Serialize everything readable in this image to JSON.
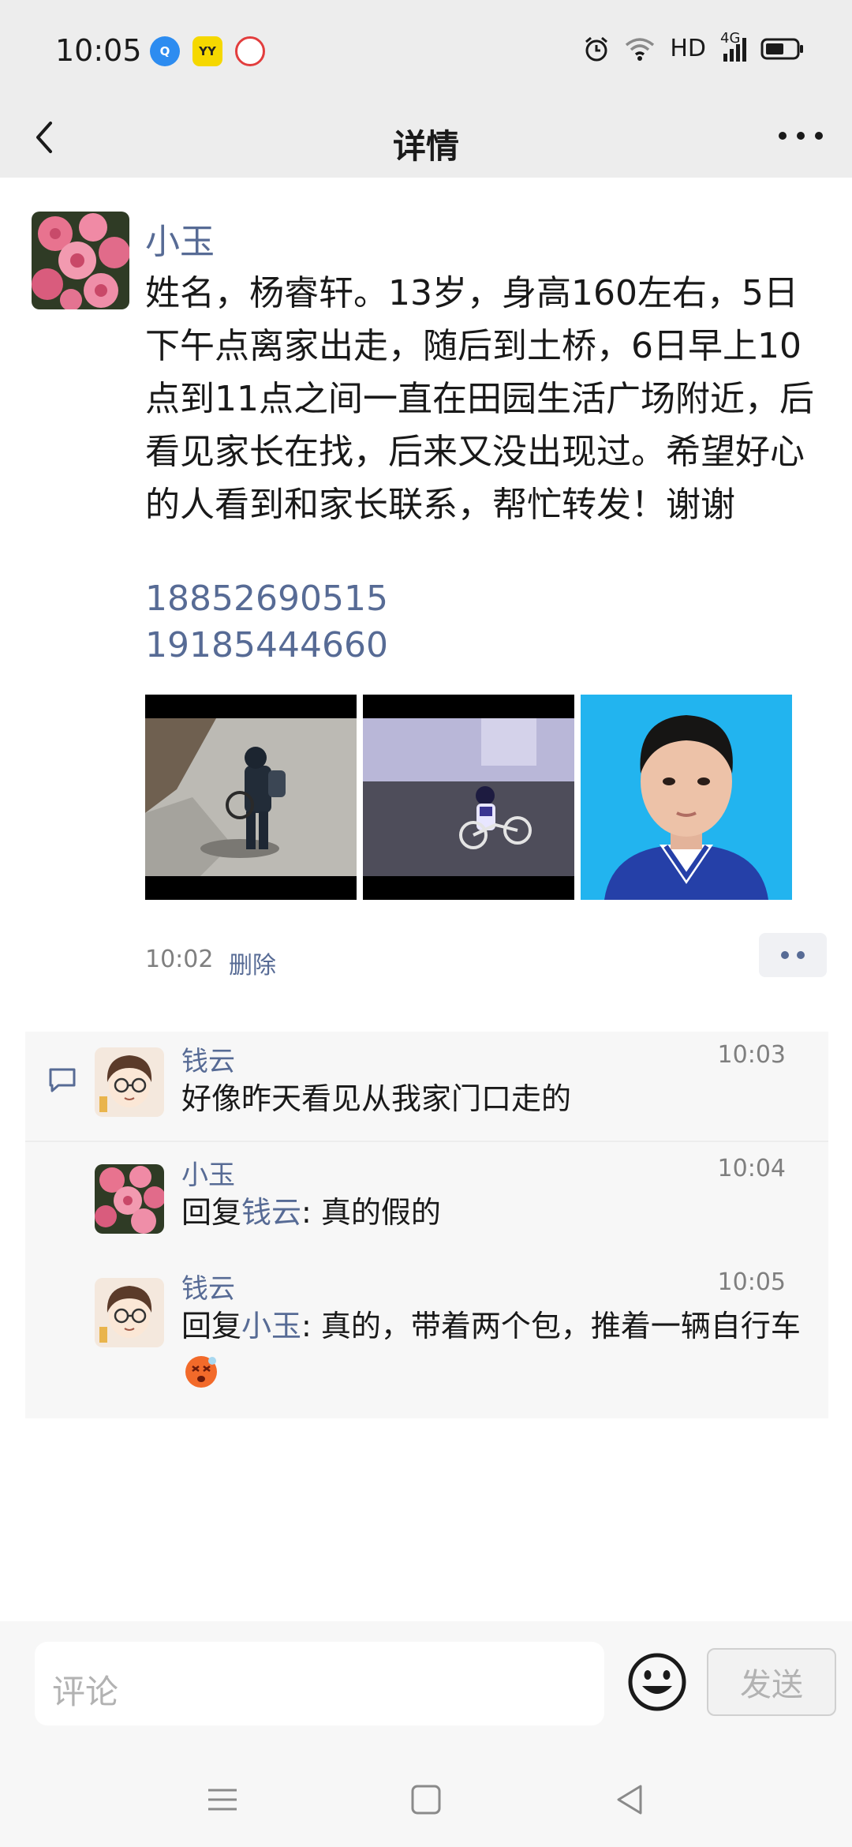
{
  "status_bar": {
    "time": "10:05",
    "app_icons": [
      {
        "name": "browser-icon",
        "glyph": "Q"
      },
      {
        "name": "yy-app-icon",
        "glyph": "YY"
      },
      {
        "name": "baidu-app-icon",
        "glyph": ""
      }
    ],
    "right_icons": [
      "alarm-icon",
      "wifi-icon",
      "signal-icon",
      "battery-icon"
    ],
    "hd_label": "HD",
    "network_label": "4G"
  },
  "nav": {
    "title": "详情"
  },
  "post": {
    "author": "小玉",
    "text": "姓名，杨睿轩。13岁，身高160左右，5日下午点离家出走，随后到土桥，6日早上10点到11点之间一直在田园生活广场附近，后看见家长在找，后来又没出现过。希望好心的人看到和家长联系，帮忙转发！谢谢",
    "phones": [
      "18852690515",
      "19185444660"
    ],
    "time": "10:02",
    "delete_label": "删除"
  },
  "comments": [
    {
      "author": "钱云",
      "time": "10:03",
      "reply_prefix": "",
      "reply_to": "",
      "text": "好像昨天看见从我家门口走的"
    },
    {
      "author": "小玉",
      "time": "10:04",
      "reply_prefix": "回复",
      "reply_to": "钱云",
      "text": ": 真的假的"
    },
    {
      "author": "钱云",
      "time": "10:05",
      "reply_prefix": "回复",
      "reply_to": "小玉",
      "text": ": 真的，带着两个包，推着一辆自行车"
    }
  ],
  "bottom_bar": {
    "comment_placeholder": "评论",
    "send_label": "发送"
  },
  "colors": {
    "link": "#576b95",
    "header_bg": "#ededed",
    "comment_bg": "#f7f7f7"
  }
}
